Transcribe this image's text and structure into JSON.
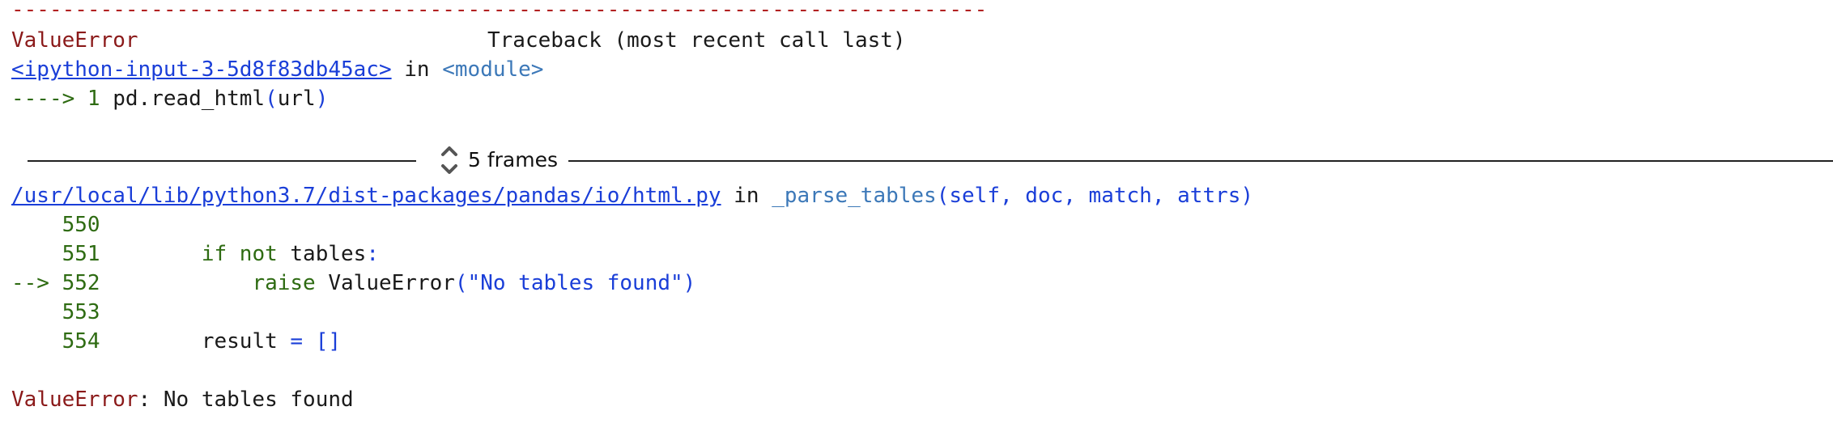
{
  "separator": "-----------------------------------------------------------------------------",
  "header": {
    "error_type": "ValueError",
    "traceback_label": "Traceback (most recent call last)"
  },
  "frame1": {
    "file_link": "<ipython-input-3-5d8f83db45ac>",
    "in_word": " in ",
    "module": "<module>",
    "arrow": "----> 1 ",
    "code": "pd.read_html",
    "paren_open": "(",
    "arg": "url",
    "paren_close": ")"
  },
  "collapsed": {
    "label": "5 frames",
    "icon": "chevron-up-down-icon"
  },
  "frame2": {
    "file_link": "/usr/local/lib/python3.7/dist-packages/pandas/io/html.py",
    "in_word": " in ",
    "func": "_parse_tables",
    "args": "(self, doc, match, attrs)",
    "lines": [
      {
        "arrow": "   ",
        "no": "550",
        "indent": "",
        "kw": "",
        "text": "",
        "tail": ""
      },
      {
        "arrow": "   ",
        "no": "551",
        "indent": "        ",
        "kw": "if not",
        "text": " tables",
        "tail": ":"
      },
      {
        "arrow": "-->",
        "no": "552",
        "indent": "            ",
        "kw": "raise",
        "text": " ValueError",
        "tail": "(\"No tables found\")"
      },
      {
        "arrow": "   ",
        "no": "553",
        "indent": "",
        "kw": "",
        "text": "",
        "tail": ""
      },
      {
        "arrow": "   ",
        "no": "554",
        "indent": "        ",
        "kw": "",
        "text": "result ",
        "tail": "= []"
      }
    ]
  },
  "final_error": {
    "type": "ValueError",
    "message": ": No tables found"
  }
}
